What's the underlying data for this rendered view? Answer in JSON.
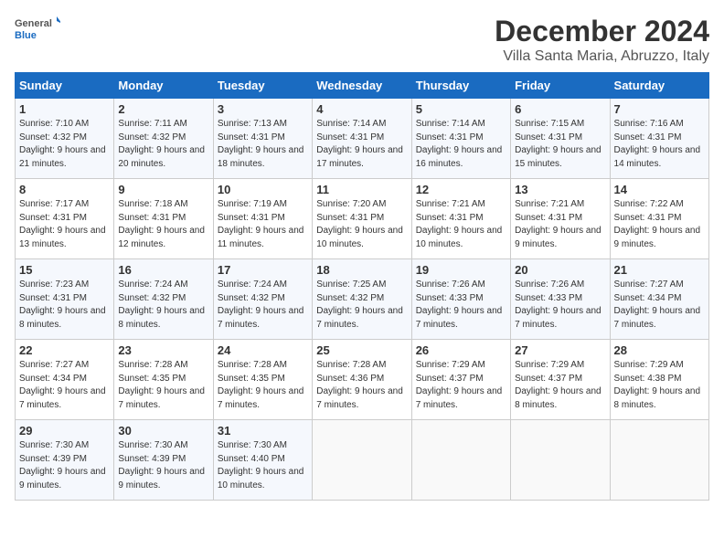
{
  "logo": {
    "general": "General",
    "blue": "Blue"
  },
  "title": "December 2024",
  "location": "Villa Santa Maria, Abruzzo, Italy",
  "days_of_week": [
    "Sunday",
    "Monday",
    "Tuesday",
    "Wednesday",
    "Thursday",
    "Friday",
    "Saturday"
  ],
  "weeks": [
    [
      {
        "day": "1",
        "sunrise": "Sunrise: 7:10 AM",
        "sunset": "Sunset: 4:32 PM",
        "daylight": "Daylight: 9 hours and 21 minutes."
      },
      {
        "day": "2",
        "sunrise": "Sunrise: 7:11 AM",
        "sunset": "Sunset: 4:32 PM",
        "daylight": "Daylight: 9 hours and 20 minutes."
      },
      {
        "day": "3",
        "sunrise": "Sunrise: 7:13 AM",
        "sunset": "Sunset: 4:31 PM",
        "daylight": "Daylight: 9 hours and 18 minutes."
      },
      {
        "day": "4",
        "sunrise": "Sunrise: 7:14 AM",
        "sunset": "Sunset: 4:31 PM",
        "daylight": "Daylight: 9 hours and 17 minutes."
      },
      {
        "day": "5",
        "sunrise": "Sunrise: 7:14 AM",
        "sunset": "Sunset: 4:31 PM",
        "daylight": "Daylight: 9 hours and 16 minutes."
      },
      {
        "day": "6",
        "sunrise": "Sunrise: 7:15 AM",
        "sunset": "Sunset: 4:31 PM",
        "daylight": "Daylight: 9 hours and 15 minutes."
      },
      {
        "day": "7",
        "sunrise": "Sunrise: 7:16 AM",
        "sunset": "Sunset: 4:31 PM",
        "daylight": "Daylight: 9 hours and 14 minutes."
      }
    ],
    [
      {
        "day": "8",
        "sunrise": "Sunrise: 7:17 AM",
        "sunset": "Sunset: 4:31 PM",
        "daylight": "Daylight: 9 hours and 13 minutes."
      },
      {
        "day": "9",
        "sunrise": "Sunrise: 7:18 AM",
        "sunset": "Sunset: 4:31 PM",
        "daylight": "Daylight: 9 hours and 12 minutes."
      },
      {
        "day": "10",
        "sunrise": "Sunrise: 7:19 AM",
        "sunset": "Sunset: 4:31 PM",
        "daylight": "Daylight: 9 hours and 11 minutes."
      },
      {
        "day": "11",
        "sunrise": "Sunrise: 7:20 AM",
        "sunset": "Sunset: 4:31 PM",
        "daylight": "Daylight: 9 hours and 10 minutes."
      },
      {
        "day": "12",
        "sunrise": "Sunrise: 7:21 AM",
        "sunset": "Sunset: 4:31 PM",
        "daylight": "Daylight: 9 hours and 10 minutes."
      },
      {
        "day": "13",
        "sunrise": "Sunrise: 7:21 AM",
        "sunset": "Sunset: 4:31 PM",
        "daylight": "Daylight: 9 hours and 9 minutes."
      },
      {
        "day": "14",
        "sunrise": "Sunrise: 7:22 AM",
        "sunset": "Sunset: 4:31 PM",
        "daylight": "Daylight: 9 hours and 9 minutes."
      }
    ],
    [
      {
        "day": "15",
        "sunrise": "Sunrise: 7:23 AM",
        "sunset": "Sunset: 4:31 PM",
        "daylight": "Daylight: 9 hours and 8 minutes."
      },
      {
        "day": "16",
        "sunrise": "Sunrise: 7:24 AM",
        "sunset": "Sunset: 4:32 PM",
        "daylight": "Daylight: 9 hours and 8 minutes."
      },
      {
        "day": "17",
        "sunrise": "Sunrise: 7:24 AM",
        "sunset": "Sunset: 4:32 PM",
        "daylight": "Daylight: 9 hours and 7 minutes."
      },
      {
        "day": "18",
        "sunrise": "Sunrise: 7:25 AM",
        "sunset": "Sunset: 4:32 PM",
        "daylight": "Daylight: 9 hours and 7 minutes."
      },
      {
        "day": "19",
        "sunrise": "Sunrise: 7:26 AM",
        "sunset": "Sunset: 4:33 PM",
        "daylight": "Daylight: 9 hours and 7 minutes."
      },
      {
        "day": "20",
        "sunrise": "Sunrise: 7:26 AM",
        "sunset": "Sunset: 4:33 PM",
        "daylight": "Daylight: 9 hours and 7 minutes."
      },
      {
        "day": "21",
        "sunrise": "Sunrise: 7:27 AM",
        "sunset": "Sunset: 4:34 PM",
        "daylight": "Daylight: 9 hours and 7 minutes."
      }
    ],
    [
      {
        "day": "22",
        "sunrise": "Sunrise: 7:27 AM",
        "sunset": "Sunset: 4:34 PM",
        "daylight": "Daylight: 9 hours and 7 minutes."
      },
      {
        "day": "23",
        "sunrise": "Sunrise: 7:28 AM",
        "sunset": "Sunset: 4:35 PM",
        "daylight": "Daylight: 9 hours and 7 minutes."
      },
      {
        "day": "24",
        "sunrise": "Sunrise: 7:28 AM",
        "sunset": "Sunset: 4:35 PM",
        "daylight": "Daylight: 9 hours and 7 minutes."
      },
      {
        "day": "25",
        "sunrise": "Sunrise: 7:28 AM",
        "sunset": "Sunset: 4:36 PM",
        "daylight": "Daylight: 9 hours and 7 minutes."
      },
      {
        "day": "26",
        "sunrise": "Sunrise: 7:29 AM",
        "sunset": "Sunset: 4:37 PM",
        "daylight": "Daylight: 9 hours and 7 minutes."
      },
      {
        "day": "27",
        "sunrise": "Sunrise: 7:29 AM",
        "sunset": "Sunset: 4:37 PM",
        "daylight": "Daylight: 9 hours and 8 minutes."
      },
      {
        "day": "28",
        "sunrise": "Sunrise: 7:29 AM",
        "sunset": "Sunset: 4:38 PM",
        "daylight": "Daylight: 9 hours and 8 minutes."
      }
    ],
    [
      {
        "day": "29",
        "sunrise": "Sunrise: 7:30 AM",
        "sunset": "Sunset: 4:39 PM",
        "daylight": "Daylight: 9 hours and 9 minutes."
      },
      {
        "day": "30",
        "sunrise": "Sunrise: 7:30 AM",
        "sunset": "Sunset: 4:39 PM",
        "daylight": "Daylight: 9 hours and 9 minutes."
      },
      {
        "day": "31",
        "sunrise": "Sunrise: 7:30 AM",
        "sunset": "Sunset: 4:40 PM",
        "daylight": "Daylight: 9 hours and 10 minutes."
      },
      null,
      null,
      null,
      null
    ]
  ]
}
